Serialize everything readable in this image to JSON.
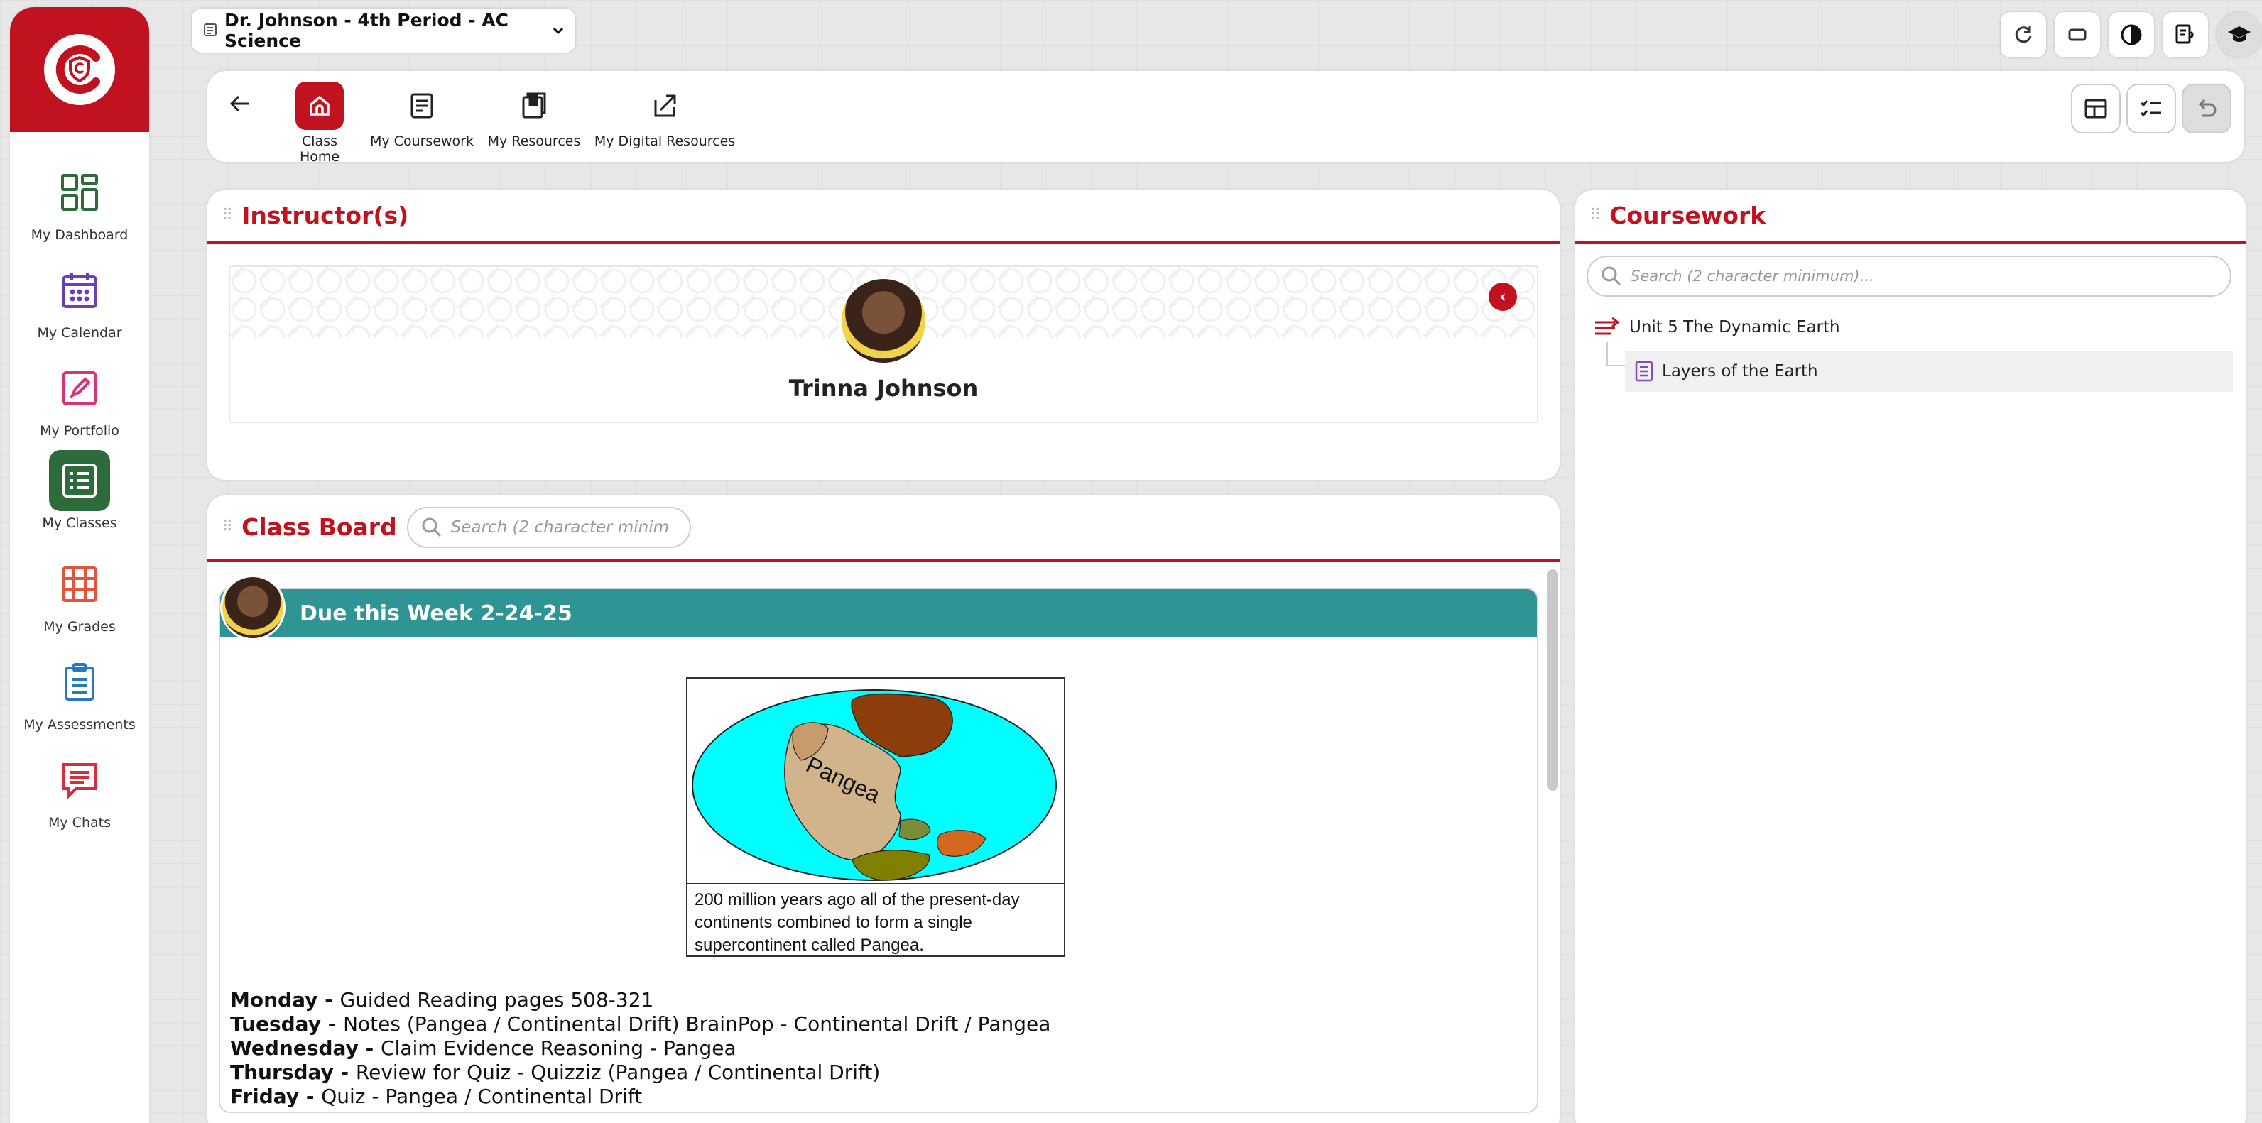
{
  "sidebar": {
    "items": [
      {
        "label": "My Dashboard",
        "icon": "dashboard-grid-icon",
        "active": false
      },
      {
        "label": "My Calendar",
        "icon": "calendar-icon",
        "active": false
      },
      {
        "label": "My Portfolio",
        "icon": "portfolio-pencil-icon",
        "active": false
      },
      {
        "label": "My Classes",
        "icon": "classes-list-icon",
        "active": true
      },
      {
        "label": "My Grades",
        "icon": "grades-table-icon",
        "active": false
      },
      {
        "label": "My Assessments",
        "icon": "assessments-clipboard-icon",
        "active": false
      },
      {
        "label": "My Chats",
        "icon": "chat-bubble-icon",
        "active": false
      }
    ]
  },
  "class_selector": {
    "value": "Dr. Johnson - 4th Period - AC Science"
  },
  "toolbar": {
    "items": [
      {
        "label": "Class Home",
        "active": true
      },
      {
        "label": "My Coursework",
        "active": false
      },
      {
        "label": "My Resources",
        "active": false
      },
      {
        "label": "My Digital Resources",
        "active": false
      }
    ]
  },
  "instructors": {
    "title": "Instructor(s)",
    "name": "Trinna Johnson"
  },
  "class_board": {
    "title": "Class Board",
    "search_placeholder": "Search (2 character minim",
    "post": {
      "title": "Due this Week 2-24-25",
      "figure_label": "Pangea",
      "figure_caption": "200 million years ago all of the present-day continents combined to form a single supercontinent called Pangea.",
      "schedule": [
        {
          "day": "Monday  - ",
          "text": "Guided Reading pages 508-321"
        },
        {
          "day": "Tuesday - ",
          "text": "Notes (Pangea / Continental Drift) BrainPop - Continental Drift / Pangea"
        },
        {
          "day": "Wednesday - ",
          "text": " Claim Evidence Reasoning - Pangea"
        },
        {
          "day": "Thursday - ",
          "text": "Review for Quiz - Quizziz (Pangea / Continental Drift)"
        },
        {
          "day": "Friday - ",
          "text": "Quiz - Pangea / Continental Drift"
        }
      ]
    }
  },
  "coursework": {
    "title": "Coursework",
    "search_placeholder": "Search (2 character minimum)...",
    "unit": "Unit 5 The Dynamic Earth",
    "lesson": "Layers of the Earth"
  },
  "colors": {
    "brand_red": "#c1121f",
    "active_green": "#2e6b3a",
    "post_teal": "#2e9494"
  }
}
